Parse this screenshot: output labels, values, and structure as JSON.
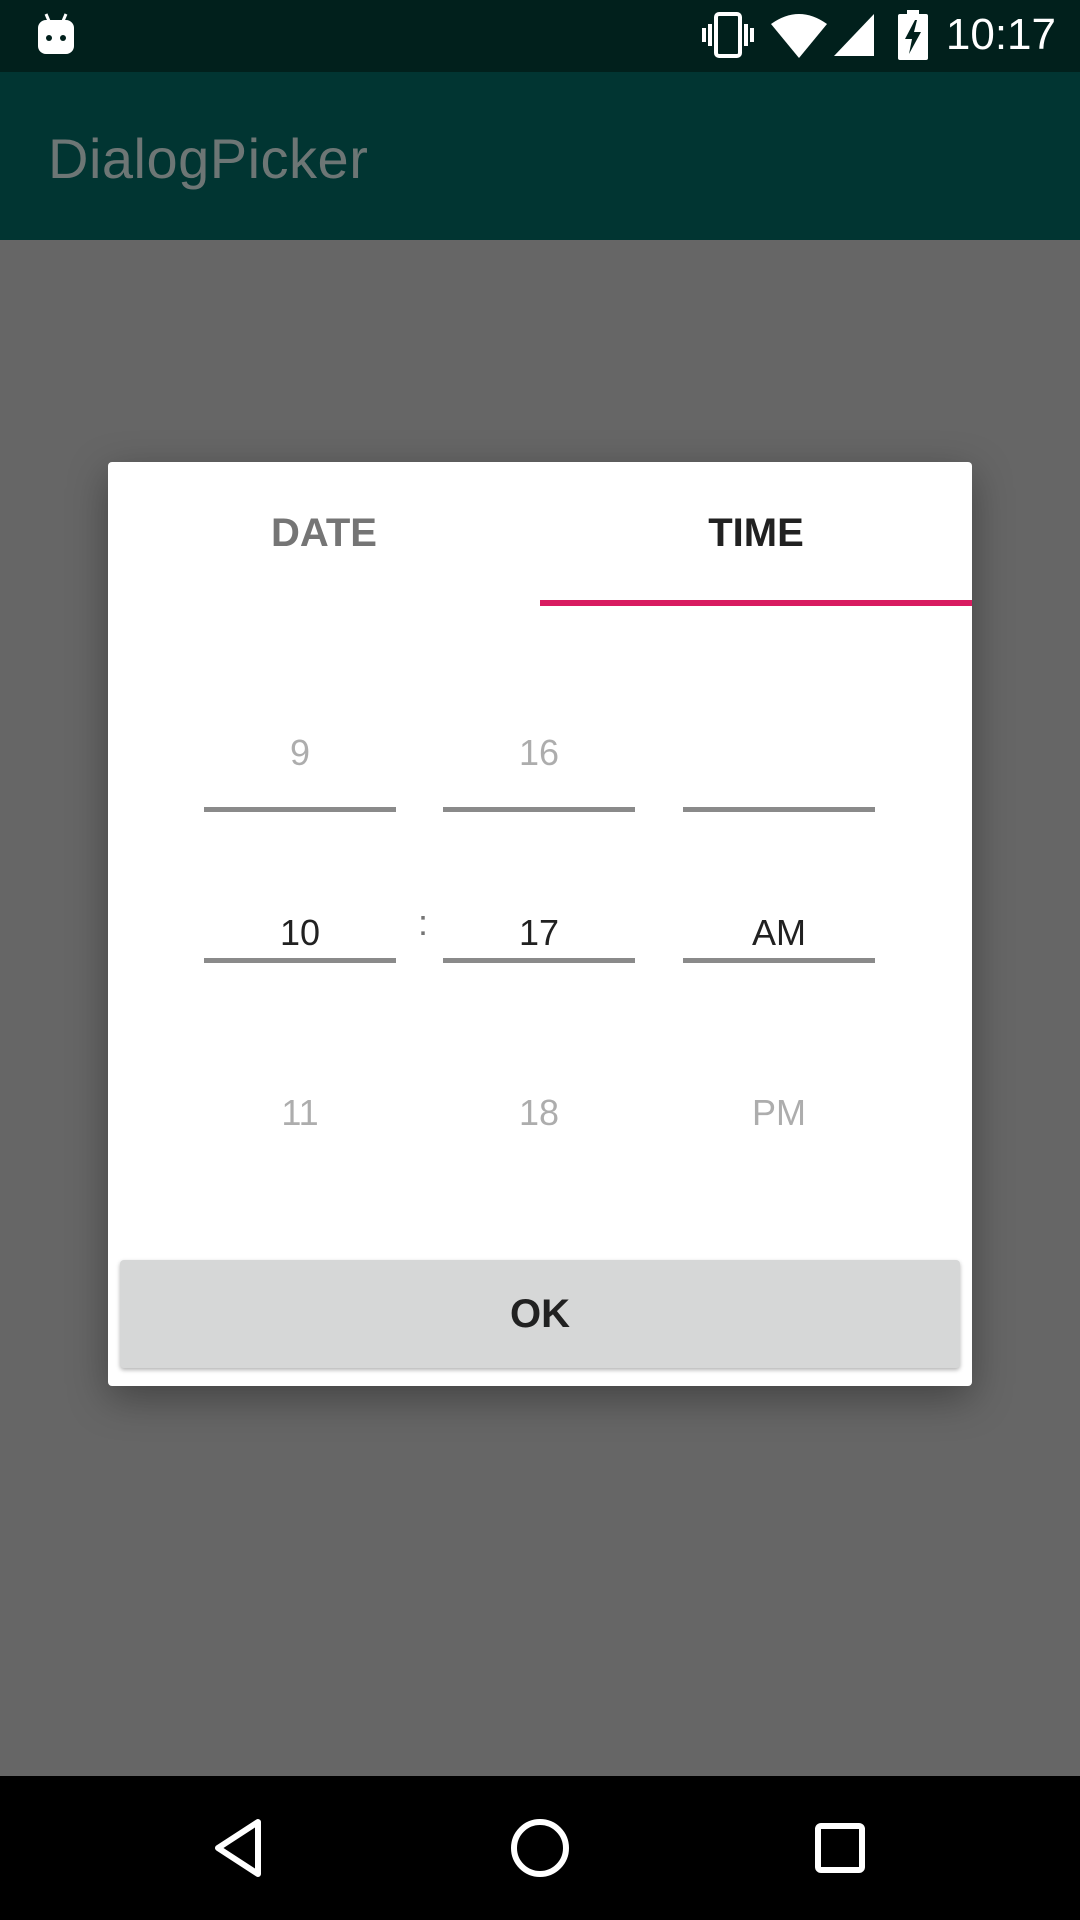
{
  "status_bar": {
    "time": "10:17",
    "icons": [
      "android-debug-icon",
      "vibrate-icon",
      "wifi-icon",
      "signal-icon",
      "battery-charging-icon"
    ]
  },
  "app_bar": {
    "title": "DialogPicker"
  },
  "dialog": {
    "tabs": [
      {
        "label": "DATE",
        "selected": false
      },
      {
        "label": "TIME",
        "selected": true
      }
    ],
    "accent_color": "#d81b60",
    "hour": {
      "prev": "9",
      "current": "10",
      "next": "11"
    },
    "separator": ":",
    "minute": {
      "prev": "16",
      "current": "17",
      "next": "18"
    },
    "ampm": {
      "prev": "",
      "current": "AM",
      "next": "PM"
    },
    "ok_label": "OK"
  },
  "nav_bar": {
    "icons": [
      "back-icon",
      "home-icon",
      "recents-icon"
    ]
  }
}
